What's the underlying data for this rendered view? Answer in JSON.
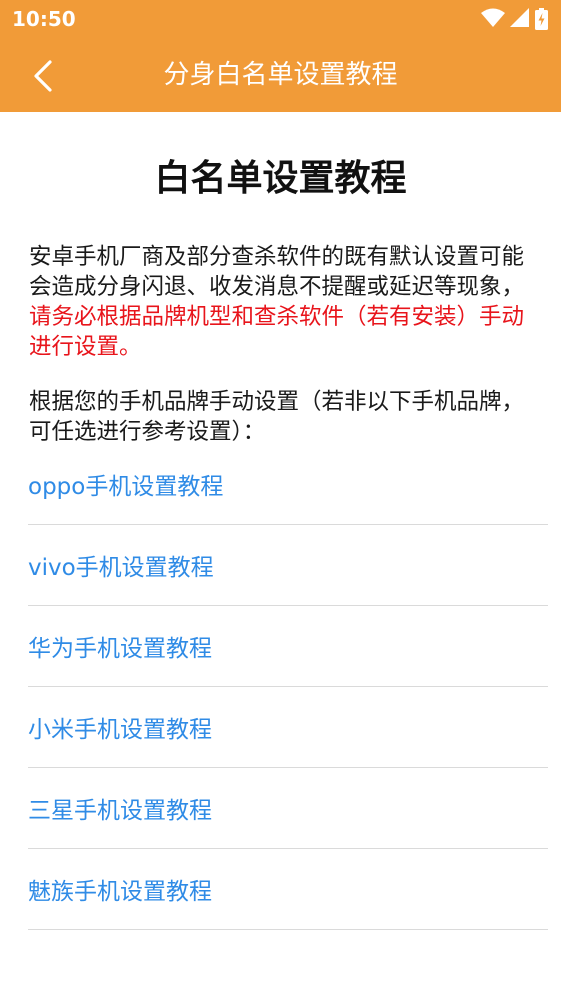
{
  "status_bar": {
    "time": "10:50"
  },
  "app_bar": {
    "title": "分身白名单设置教程"
  },
  "page": {
    "title": "白名单设置教程",
    "intro_normal": "安卓手机厂商及部分查杀软件的既有默认设置可能会造成分身闪退、收发消息不提醒或延迟等现象，",
    "intro_warning": "请务必根据品牌机型和查杀软件（若有安装）手动进行设置。",
    "instruction": "根据您的手机品牌手动设置（若非以下手机品牌，可任选进行参考设置）："
  },
  "brands": [
    {
      "label": "oppo手机设置教程"
    },
    {
      "label": "vivo手机设置教程"
    },
    {
      "label": "华为手机设置教程"
    },
    {
      "label": "小米手机设置教程"
    },
    {
      "label": "三星手机设置教程"
    },
    {
      "label": "魅族手机设置教程"
    }
  ],
  "colors": {
    "app_bar": "#F19B38",
    "link": "#2F8BE6",
    "warning": "#E8141B",
    "divider": "#DADADA"
  }
}
